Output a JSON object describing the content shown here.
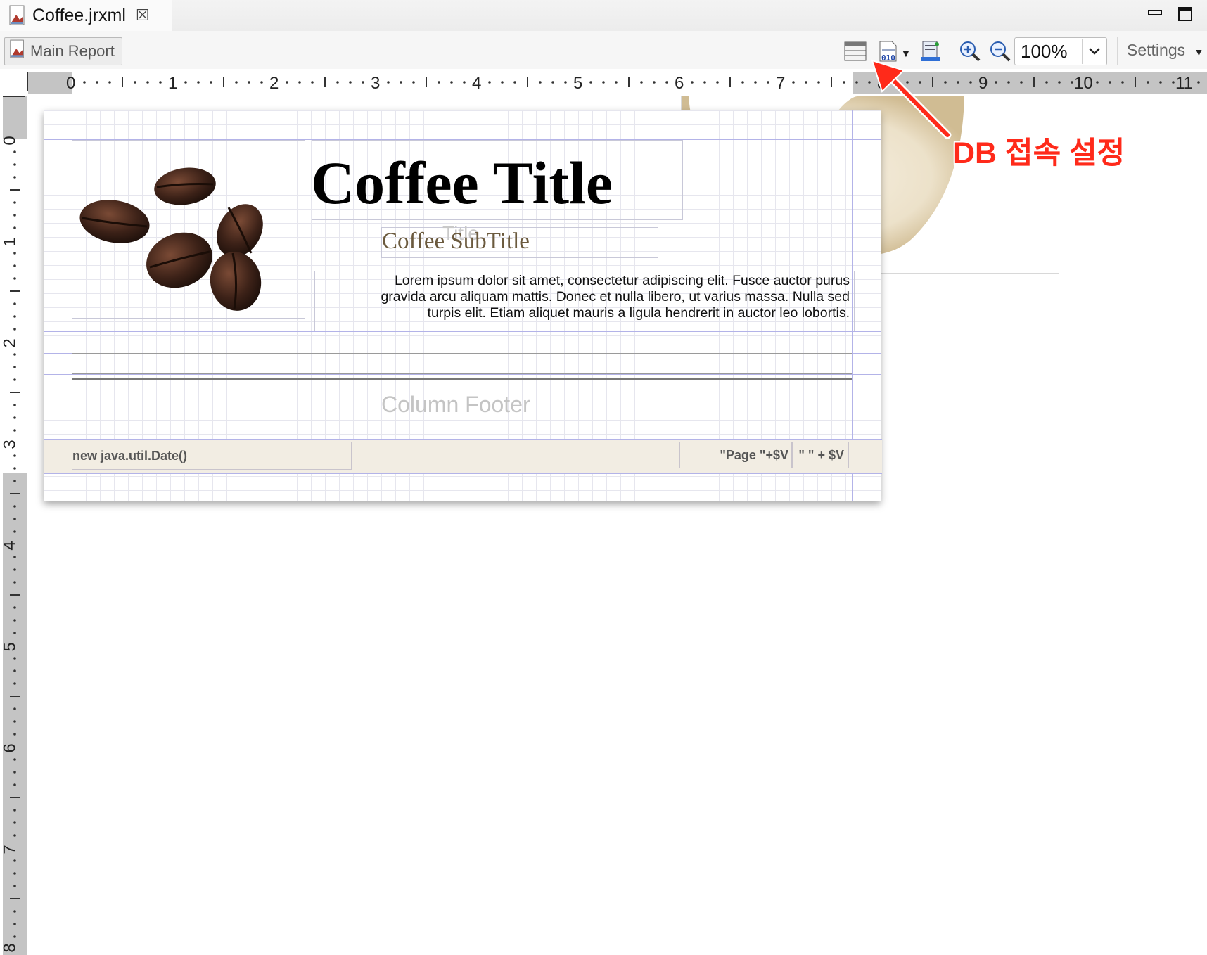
{
  "tab": {
    "title": "Coffee.jrxml",
    "close_glyph": "☒"
  },
  "toolbar": {
    "main_report_label": "Main Report",
    "zoom_value": "100%",
    "settings_label": "Settings",
    "icons": [
      "dataset-adapter-icon",
      "datasource-binary-icon",
      "report-preview-icon",
      "zoom-in-icon",
      "zoom-out-icon"
    ]
  },
  "ruler": {
    "horizontal_marks": [
      "0",
      "1",
      "2",
      "3",
      "4",
      "5",
      "6",
      "7",
      "8",
      "9",
      "10",
      "11"
    ],
    "vertical_marks": [
      "0",
      "1",
      "2",
      "3",
      "4",
      "5",
      "6",
      "7",
      "8"
    ]
  },
  "report": {
    "title": "Coffee Title",
    "title_ghost": "Title",
    "subtitle": "Coffee SubTitle",
    "lorem_lines": [
      "Lorem ipsum dolor sit amet, consectetur adipiscing elit. Fusce auctor purus",
      "gravida arcu aliquam mattis. Donec et nulla libero, ut varius massa. Nulla sed",
      "turpis elit. Etiam aliquet mauris a ligula hendrerit in auctor leo lobortis."
    ],
    "column_footer": "Column Footer",
    "footer_date_expr": "new java.util.Date()",
    "footer_page_expr": "\"Page \"+$V",
    "footer_total_expr": "\" \" + $V"
  },
  "annotation": {
    "text": "DB 접속 설정",
    "color": "#ff2a1a"
  },
  "colors": {
    "guide": "#b3b3e8",
    "footer_band": "#f2ede3",
    "ruler_gray": "#c4c4c4"
  }
}
